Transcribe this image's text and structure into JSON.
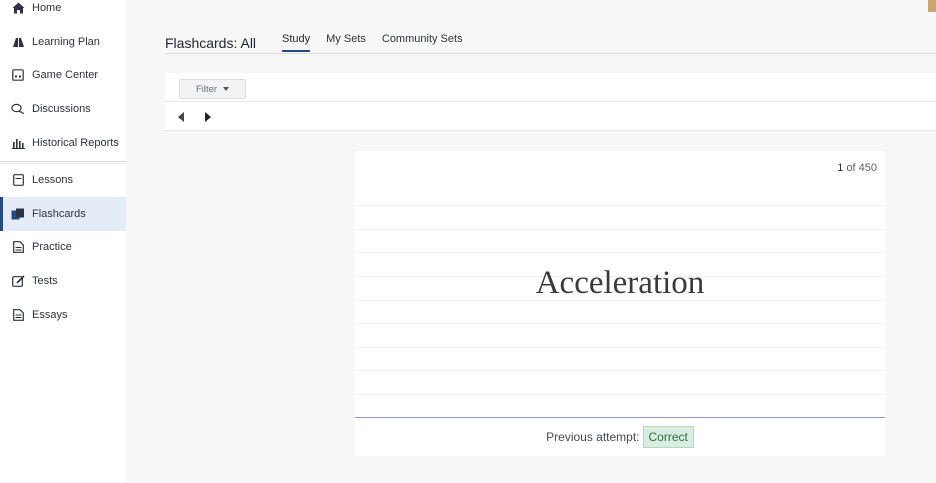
{
  "sidebar": {
    "items": [
      {
        "label": "Home",
        "icon": "home-icon"
      },
      {
        "label": "Learning Plan",
        "icon": "learning-plan-icon"
      },
      {
        "label": "Game Center",
        "icon": "game-center-icon"
      },
      {
        "label": "Discussions",
        "icon": "discussions-icon"
      },
      {
        "label": "Historical Reports",
        "icon": "bar-chart-icon"
      },
      {
        "label": "Lessons",
        "icon": "lessons-icon"
      },
      {
        "label": "Flashcards",
        "icon": "flashcards-icon"
      },
      {
        "label": "Practice",
        "icon": "practice-icon"
      },
      {
        "label": "Tests",
        "icon": "tests-icon"
      },
      {
        "label": "Essays",
        "icon": "essays-icon"
      }
    ],
    "active": "Flashcards"
  },
  "header": {
    "title": "Flashcards: All",
    "tabs": [
      {
        "label": "Study"
      },
      {
        "label": "My Sets"
      },
      {
        "label": "Community Sets"
      }
    ],
    "active_tab": "Study"
  },
  "filter": {
    "label": "Filter"
  },
  "card": {
    "position": "1",
    "of_text": "of",
    "total": "450",
    "term": "Acceleration",
    "attempt_label": "Previous attempt:",
    "attempt_result": "Correct"
  },
  "colors": {
    "accent": "#244a86",
    "active_bg": "#e3ecf7",
    "correct_bg": "#d8eddf",
    "correct_text": "#2f6b45"
  }
}
